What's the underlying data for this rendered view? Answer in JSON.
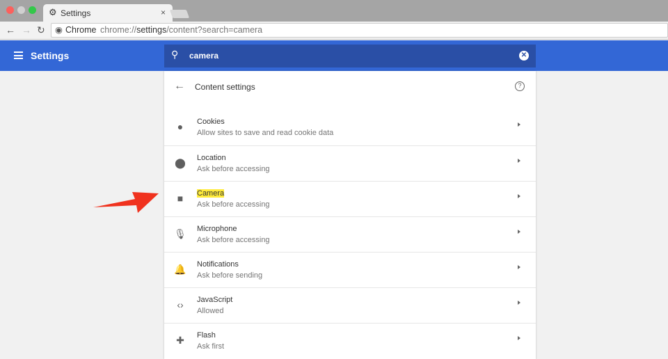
{
  "browser": {
    "tab_title": "Settings",
    "omnibox_origin": "Chrome",
    "url_prefix": "chrome://",
    "url_host": "settings",
    "url_path": "/content?search=camera"
  },
  "header": {
    "title": "Settings",
    "search_value": "camera"
  },
  "panel": {
    "title": "Content settings",
    "items": [
      {
        "label": "Cookies",
        "sub": "Allow sites to save and read cookie data",
        "icon": "cookie-icon"
      },
      {
        "label": "Location",
        "sub": "Ask before accessing",
        "icon": "location-pin-icon"
      },
      {
        "label": "Camera",
        "sub": "Ask before accessing",
        "icon": "videocam-icon",
        "highlighted": true
      },
      {
        "label": "Microphone",
        "sub": "Ask before accessing",
        "icon": "mic-icon"
      },
      {
        "label": "Notifications",
        "sub": "Ask before sending",
        "icon": "bell-icon"
      },
      {
        "label": "JavaScript",
        "sub": "Allowed",
        "icon": "code-icon"
      },
      {
        "label": "Flash",
        "sub": "Ask first",
        "icon": "puzzle-icon"
      }
    ]
  },
  "colors": {
    "header": "#3367d6",
    "search": "#2a4fa6",
    "highlight": "#ffeb3b",
    "annotation_arrow": "#f0321e"
  }
}
